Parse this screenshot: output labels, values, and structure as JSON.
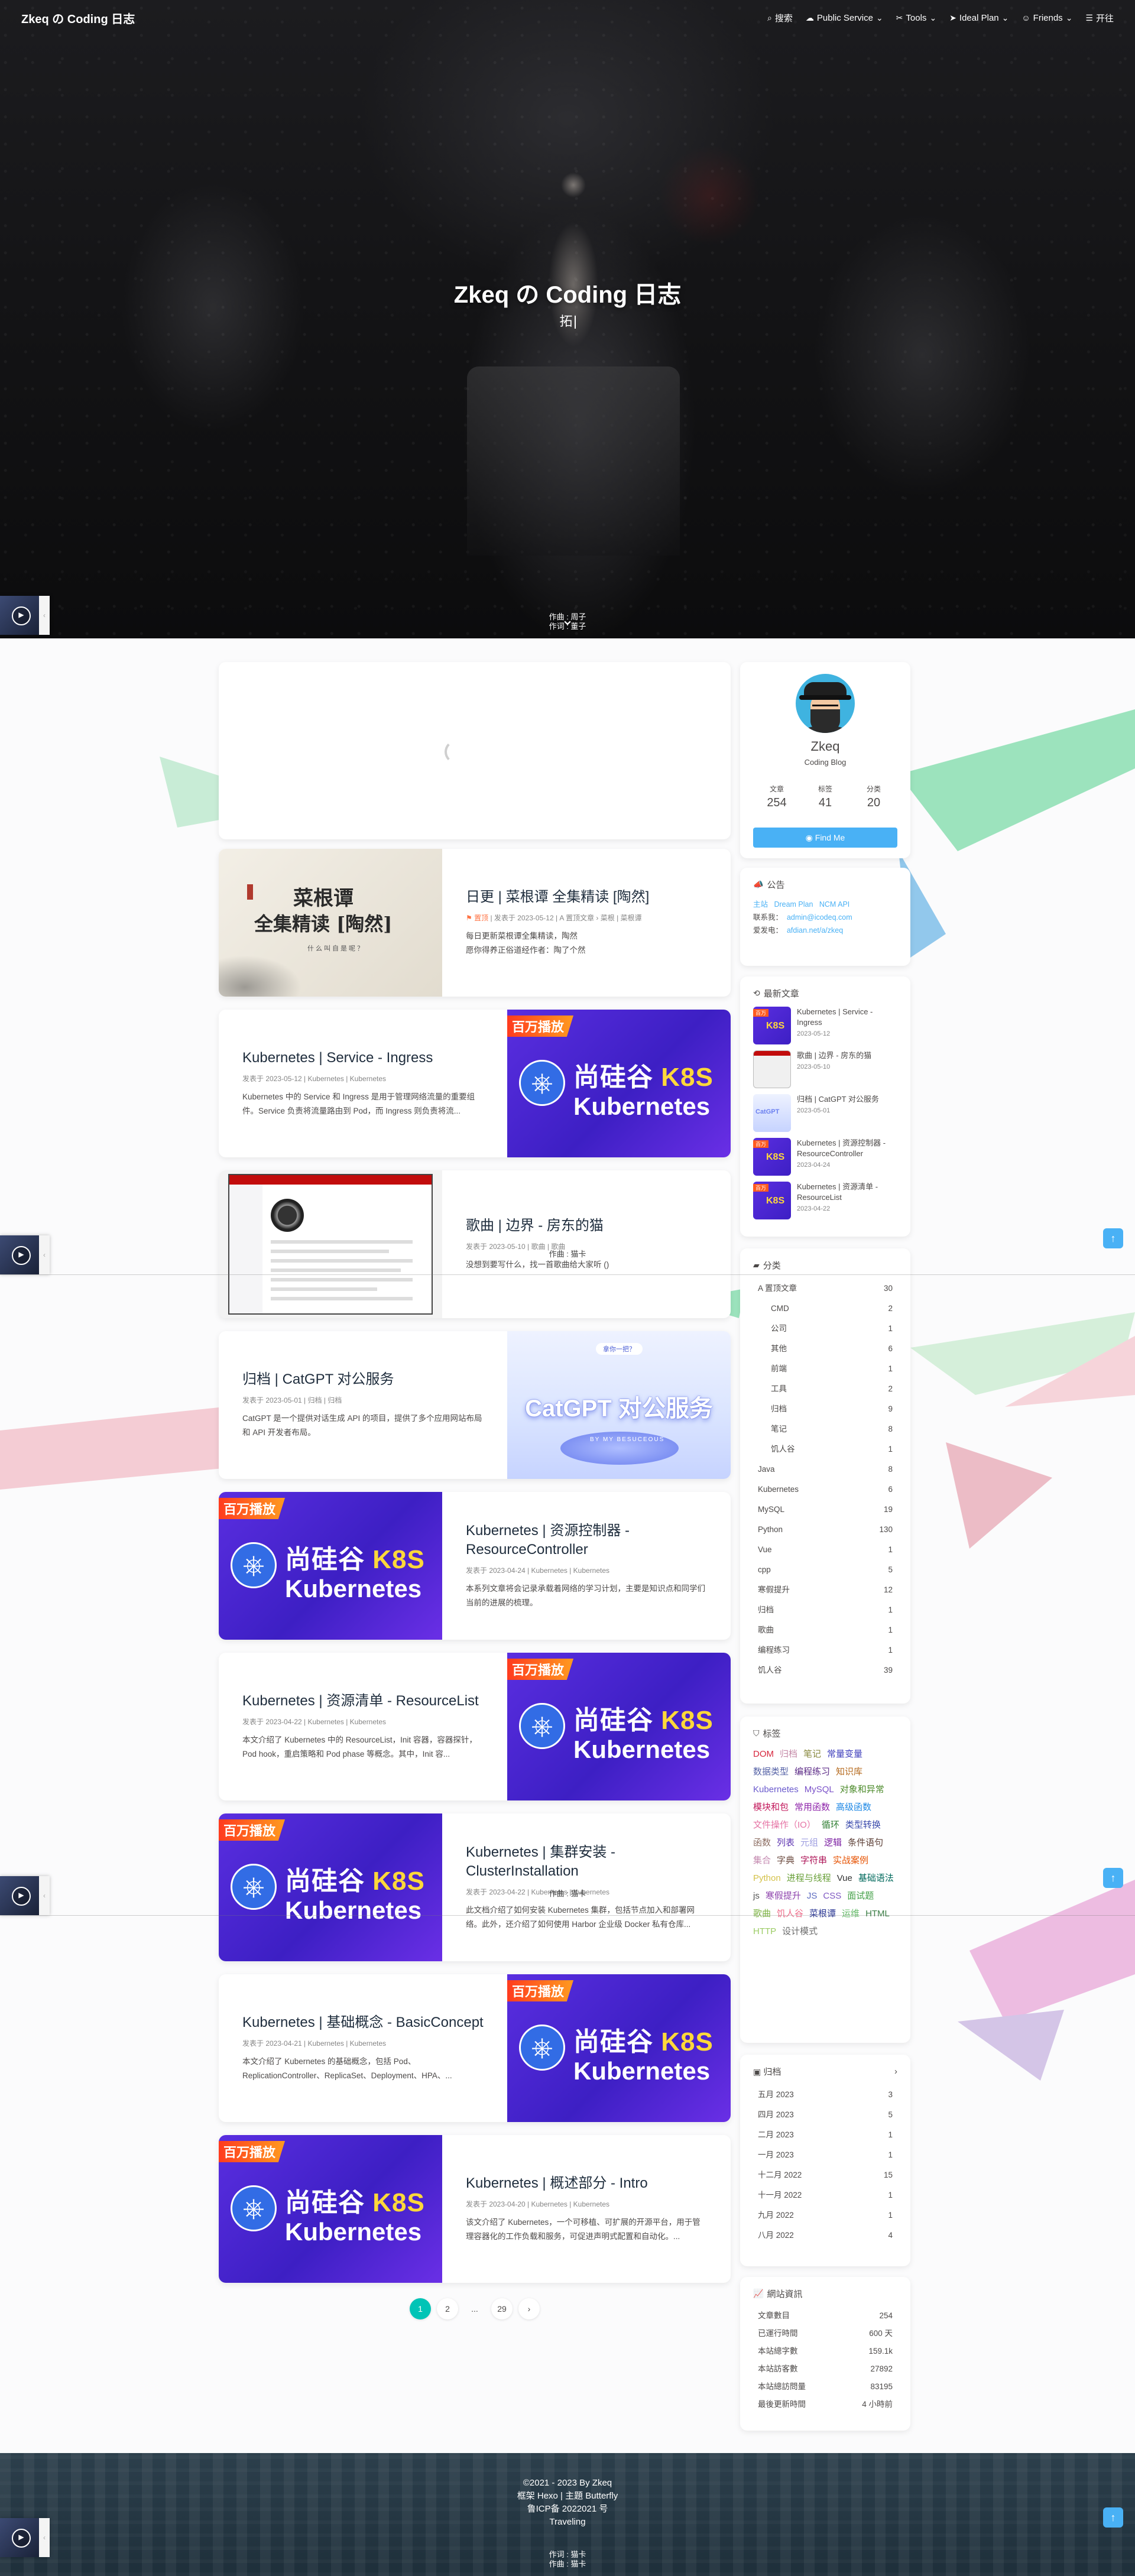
{
  "site": {
    "name": "Zkeq の Coding 日志"
  },
  "nav": [
    {
      "icon": "search-icon",
      "glyph": "⌕",
      "label": "搜索"
    },
    {
      "icon": "cloud-icon",
      "glyph": "☁",
      "label": "Public Service"
    },
    {
      "icon": "tools-icon",
      "glyph": "✂",
      "label": "Tools"
    },
    {
      "icon": "paper-plane-icon",
      "glyph": "➤",
      "label": "Ideal Plan"
    },
    {
      "icon": "users-icon",
      "glyph": "☺",
      "label": "Friends"
    },
    {
      "icon": "list-icon",
      "glyph": "☰",
      "label": "开往"
    }
  ],
  "hero": {
    "title": "Zkeq の Coding 日志",
    "subtitle": "拓"
  },
  "player": {
    "lyric_1": "作曲 : 周子",
    "lyric_1b": "作词 : 董子",
    "lyric_2": "作曲 : 猫卡",
    "lyric_3": "作曲 : 猫卡",
    "lyric_4": "作词 : 猫卡",
    "lyric_4b": "作曲 : 猫卡"
  },
  "posts": [
    {
      "title": "日更 | 菜根谭 全集精读 [陶然]",
      "sticky": "置顶",
      "meta": "发表于 2023-05-12 | A 置顶文章 › 菜根 | 菜根谭",
      "excerpt_1": "每日更新菜根谭全集精读，陶然",
      "excerpt_2": "愿你得养正俗道经作者：陶了个然",
      "cover": "caigen",
      "cover_title_1": "菜根谭",
      "cover_title_2": "全集精读 [陶然]",
      "cover_sub": "什么叫自是呢？"
    },
    {
      "title": "Kubernetes | Service - Ingress",
      "meta": "发表于 2023-05-12 | Kubernetes | Kubernetes",
      "excerpt": "Kubernetes 中的 Service 和 Ingress 是用于管理网络流量的重要组件。Service 负责将流量路由到 Pod，而 Ingress 则负责将流...",
      "cover": "k8s"
    },
    {
      "title": "歌曲 | 边界 - 房东的猫",
      "meta": "发表于 2023-05-10 | 歌曲 | 歌曲",
      "excerpt": "没想到要写什么，找一首歌曲给大家听 ()",
      "cover": "netease"
    },
    {
      "title": "归档 | CatGPT 对公服务",
      "meta": "发表于 2023-05-01 | 归档 | 归档",
      "excerpt": "CatGPT 是一个提供对话生成 API 的项目，提供了多个应用网站布局和 API 开发者布局。",
      "cover": "gpt",
      "cover_pill": "拿你一把？",
      "cover_title": "CatGPT 对公服务",
      "cover_sub": "BY MY BESUCEOUS"
    },
    {
      "title": "Kubernetes | 资源控制器 - ResourceController",
      "meta": "发表于 2023-04-24 | Kubernetes | Kubernetes",
      "excerpt": "本系列文章将会记录承载着网络的学习计划，主要是知识点和同学们当前的进展的梳理。",
      "cover": "k8s"
    },
    {
      "title": "Kubernetes | 资源清单 - ResourceList",
      "meta": "发表于 2023-04-22 | Kubernetes | Kubernetes",
      "excerpt": "本文介绍了 Kubernetes 中的 ResourceList，Init 容器，容器探针，Pod hook，重启策略和 Pod phase 等概念。其中，Init 容...",
      "cover": "k8s"
    },
    {
      "title": "Kubernetes | 集群安装 - ClusterInstallation",
      "meta": "发表于 2023-04-22 | Kubernetes | Kubernetes",
      "excerpt": "此文档介绍了如何安装 Kubernetes 集群，包括节点加入和部署网络。此外，还介绍了如何使用 Harbor 企业级 Docker 私有仓库...",
      "cover": "k8s"
    },
    {
      "title": "Kubernetes | 基础概念 - BasicConcept",
      "meta": "发表于 2023-04-21 | Kubernetes | Kubernetes",
      "excerpt": "本文介绍了 Kubernetes 的基础概念，包括 Pod、ReplicationController、ReplicaSet、Deployment、HPA、...",
      "cover": "k8s"
    },
    {
      "title": "Kubernetes | 概述部分 - Intro",
      "meta": "发表于 2023-04-20 | Kubernetes | Kubernetes",
      "excerpt": "该文介绍了 Kubernetes，一个可移植、可扩展的开源平台，用于管理容器化的工作负载和服务，可促进声明式配置和自动化。...",
      "cover": "k8s"
    }
  ],
  "k8s_cover": {
    "badge": "百万播放",
    "title_a": "尚硅谷 ",
    "title_b": "K8S",
    "title_c": "Kubernetes",
    "glyph": "⎈"
  },
  "pagination": [
    "1",
    "2",
    "...",
    "29",
    "›"
  ],
  "author": {
    "name": "Zkeq",
    "desc": "Coding Blog",
    "articles_label": "文章",
    "articles": "254",
    "tags_label": "标签",
    "tags": "41",
    "categories_label": "分类",
    "categories": "20",
    "follow": "Find Me"
  },
  "announcement": {
    "title": "公告",
    "line1_a": "主站",
    "line1_b": "Dream Plan",
    "line1_c": "NCM API",
    "line2_label": "联系我：",
    "line2_value": "admin@icodeq.com",
    "line3_label": "爱发电：",
    "line3_value": "afdian.net/a/zkeq"
  },
  "recent": {
    "title": "最新文章",
    "items": [
      {
        "title": "Kubernetes | Service - Ingress",
        "date": "2023-05-12",
        "thumb": "k8s"
      },
      {
        "title": "歌曲 | 边界 - 房东的猫",
        "date": "2023-05-10",
        "thumb": "net"
      },
      {
        "title": "归档 | CatGPT 对公服务",
        "date": "2023-05-01",
        "thumb": "gpt"
      },
      {
        "title": "Kubernetes | 资源控制器 - ResourceController",
        "date": "2023-04-24",
        "thumb": "k8s"
      },
      {
        "title": "Kubernetes | 资源清单 - ResourceList",
        "date": "2023-04-22",
        "thumb": "k8s"
      }
    ]
  },
  "categories": {
    "title": "分类",
    "items": [
      {
        "name": "A 置顶文章",
        "count": "30",
        "child": false
      },
      {
        "name": "CMD",
        "count": "2",
        "child": true
      },
      {
        "name": "公司",
        "count": "1",
        "child": true
      },
      {
        "name": "其他",
        "count": "6",
        "child": true
      },
      {
        "name": "前端",
        "count": "1",
        "child": true
      },
      {
        "name": "工具",
        "count": "2",
        "child": true
      },
      {
        "name": "归档",
        "count": "9",
        "child": true
      },
      {
        "name": "笔记",
        "count": "8",
        "child": true
      },
      {
        "name": "饥人谷",
        "count": "1",
        "child": true
      },
      {
        "name": "Java",
        "count": "8",
        "child": false
      },
      {
        "name": "Kubernetes",
        "count": "6",
        "child": false
      },
      {
        "name": "MySQL",
        "count": "19",
        "child": false
      },
      {
        "name": "Python",
        "count": "130",
        "child": false
      },
      {
        "name": "Vue",
        "count": "1",
        "child": false
      },
      {
        "name": "cpp",
        "count": "5",
        "child": false
      },
      {
        "name": "寒假提升",
        "count": "12",
        "child": false
      },
      {
        "name": "归档",
        "count": "1",
        "child": false
      },
      {
        "name": "歌曲",
        "count": "1",
        "child": false
      },
      {
        "name": "编程练习",
        "count": "1",
        "child": false
      },
      {
        "name": "饥人谷",
        "count": "39",
        "child": false
      }
    ]
  },
  "tags": {
    "title": "标签",
    "items": [
      {
        "name": "DOM",
        "color": "#d7263d"
      },
      {
        "name": "归档",
        "color": "#c58aa8"
      },
      {
        "name": "笔记",
        "color": "#8a8a40"
      },
      {
        "name": "常量变量",
        "color": "#3d3dbb"
      },
      {
        "name": "数据类型",
        "color": "#5562a6"
      },
      {
        "name": "编程练习",
        "color": "#5b2a86"
      },
      {
        "name": "知识库",
        "color": "#b56a1e"
      },
      {
        "name": "Kubernetes",
        "color": "#6a5acd"
      },
      {
        "name": "MySQL",
        "color": "#7b52c9"
      },
      {
        "name": "对象和异常",
        "color": "#4b8a2a"
      },
      {
        "name": "模块和包",
        "color": "#c2185b"
      },
      {
        "name": "常用函数",
        "color": "#8e24aa"
      },
      {
        "name": "高级函数",
        "color": "#1e88e5"
      },
      {
        "name": "文件操作（IO）",
        "color": "#e573a4"
      },
      {
        "name": "循环",
        "color": "#2e7d32"
      },
      {
        "name": "类型转换",
        "color": "#3949ab"
      },
      {
        "name": "函数",
        "color": "#8d6e63"
      },
      {
        "name": "列表",
        "color": "#5e35b1"
      },
      {
        "name": "元组",
        "color": "#9e9ee0"
      },
      {
        "name": "逻辑",
        "color": "#7b1fa2"
      },
      {
        "name": "条件语句",
        "color": "#5d4037"
      },
      {
        "name": "集合",
        "color": "#c48ab0"
      },
      {
        "name": "字典",
        "color": "#6d4c41"
      },
      {
        "name": "字符串",
        "color": "#ad1457"
      },
      {
        "name": "实战案例",
        "color": "#e65100"
      },
      {
        "name": "Python",
        "color": "#d4c24a"
      },
      {
        "name": "进程与线程",
        "color": "#689f38"
      },
      {
        "name": "Vue",
        "color": "#333333"
      },
      {
        "name": "基础语法",
        "color": "#00695c"
      },
      {
        "name": "js",
        "color": "#555555"
      },
      {
        "name": "寒假提升",
        "color": "#8e44ad"
      },
      {
        "name": "JS",
        "color": "#5c6bc0"
      },
      {
        "name": "CSS",
        "color": "#7e57c2"
      },
      {
        "name": "面试题",
        "color": "#43a047"
      },
      {
        "name": "歌曲",
        "color": "#7cb342"
      },
      {
        "name": "饥人谷",
        "color": "#ef6c8a"
      },
      {
        "name": "菜根谭",
        "color": "#283593"
      },
      {
        "name": "运维",
        "color": "#66bb6a"
      },
      {
        "name": "HTML",
        "color": "#3a7d44"
      },
      {
        "name": "HTTP",
        "color": "#9ccc65"
      },
      {
        "name": "设计模式",
        "color": "#6d6d6d"
      }
    ]
  },
  "archives": {
    "title": "归档",
    "items": [
      {
        "month": "五月 2023",
        "count": "3"
      },
      {
        "month": "四月 2023",
        "count": "5"
      },
      {
        "month": "二月 2023",
        "count": "1"
      },
      {
        "month": "一月 2023",
        "count": "1"
      },
      {
        "month": "十二月 2022",
        "count": "15"
      },
      {
        "month": "十一月 2022",
        "count": "1"
      },
      {
        "month": "九月 2022",
        "count": "1"
      },
      {
        "month": "八月 2022",
        "count": "4"
      }
    ]
  },
  "webinfo": {
    "title": "網站資訊",
    "items": [
      {
        "label": "文章數目",
        "value": "254"
      },
      {
        "label": "已運行時間",
        "value": "600 天"
      },
      {
        "label": "本站總字數",
        "value": "159.1k"
      },
      {
        "label": "本站訪客數",
        "value": "27892"
      },
      {
        "label": "本站總訪問量",
        "value": "83195"
      },
      {
        "label": "最後更新時間",
        "value": "4 小時前"
      }
    ]
  },
  "footer": {
    "copyright": "©2021 - 2023 By Zkeq",
    "framework": "框架 Hexo | 主題 Butterfly",
    "icp": "鲁ICP备 2022021 号",
    "status": "Traveling"
  },
  "colors": {
    "accent": "#49b1f5",
    "pagination": "#00c4b6",
    "sticky": "#ff7242"
  }
}
